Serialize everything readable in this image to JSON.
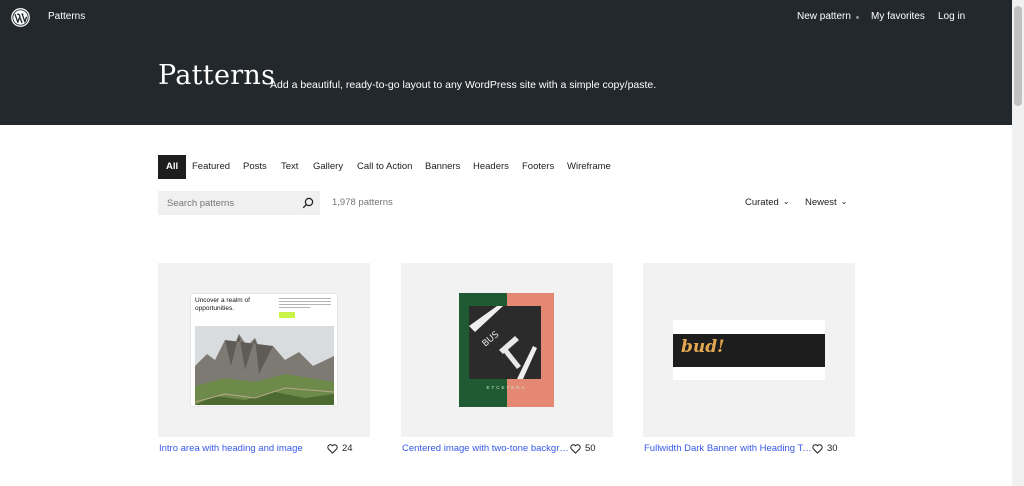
{
  "header": {
    "site_title": "Patterns",
    "nav": {
      "new_pattern": "New pattern",
      "my_favorites": "My favorites",
      "log_in": "Log in"
    },
    "hero_title": "Patterns",
    "hero_description": "Add a beautiful, ready-to-go layout to any WordPress site with a simple copy/paste."
  },
  "filters": {
    "tabs": [
      "All",
      "Featured",
      "Posts",
      "Text",
      "Gallery",
      "Call to Action",
      "Banners",
      "Headers",
      "Footers",
      "Wireframe"
    ],
    "active_tab": "All"
  },
  "search": {
    "placeholder": "Search patterns",
    "count": "1,978 patterns"
  },
  "sort": {
    "curation": "Curated",
    "order": "Newest"
  },
  "cards": [
    {
      "title": "Intro area with heading and image",
      "likes": "24",
      "preview": {
        "heading": "Uncover a realm of opportunities."
      }
    },
    {
      "title": "Centered image with two-tone backgro...",
      "likes": "50",
      "preview": {
        "caption": "ETCETERA"
      }
    },
    {
      "title": "Fullwidth Dark Banner with Heading To...",
      "likes": "30",
      "preview": {
        "text": "bud!"
      }
    }
  ],
  "colors": {
    "header_bg": "#23282d",
    "link": "#3858e9",
    "card_bg": "#f2f2f2",
    "active_tab_bg": "#1e1e1e"
  }
}
